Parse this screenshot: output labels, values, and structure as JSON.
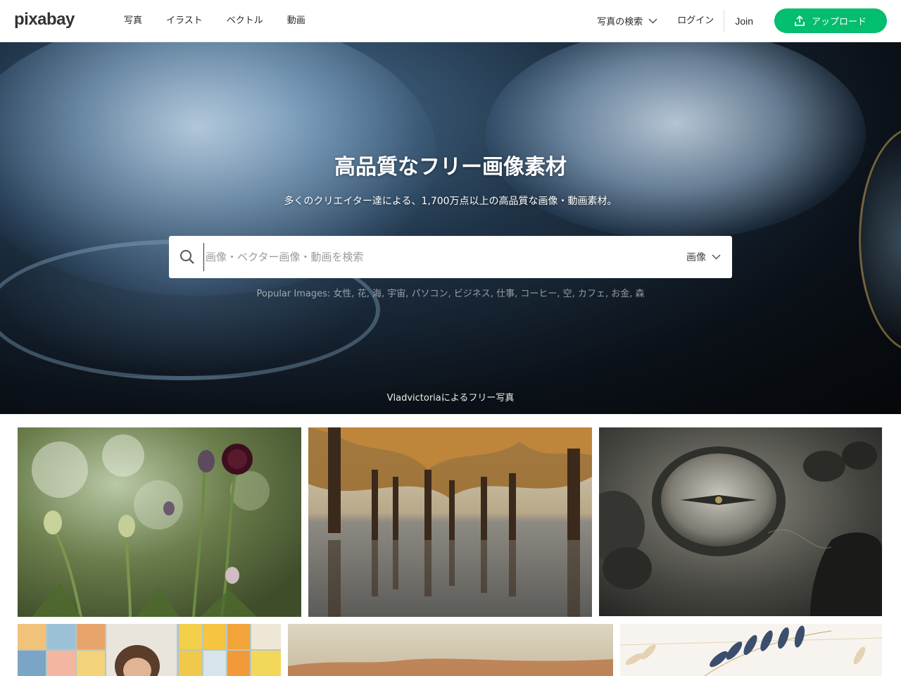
{
  "header": {
    "logo": "pixabay",
    "nav": [
      "写真",
      "イラスト",
      "ベクトル",
      "動画"
    ],
    "search_type": "写真の検索",
    "login": "ログイン",
    "join": "Join",
    "upload": "アップロード"
  },
  "hero": {
    "title": "高品質なフリー画像素材",
    "subtitle": "多くのクリエイター達による、1,700万点以上の高品質な画像・動画素材。",
    "search_placeholder": "画像・ベクター画像・動画を検索",
    "filter": "画像",
    "popular_prefix": "Popular Images:",
    "popular_terms": [
      "女性",
      "花",
      "海",
      "宇宙",
      "パソコン",
      "ビジネス",
      "仕事",
      "コーヒー",
      "空",
      "カフェ",
      "お金",
      "森"
    ],
    "credit": "Vladvictoriaによるフリー写真"
  },
  "colors": {
    "accent": "#02be6e",
    "text": "#2a2a2a"
  },
  "gallery_icons": [
    "flowers-photo",
    "flooded-forest-photo",
    "compass-photo",
    "woman-lockers-photo",
    "landscape-photo",
    "leaves-illustration"
  ]
}
